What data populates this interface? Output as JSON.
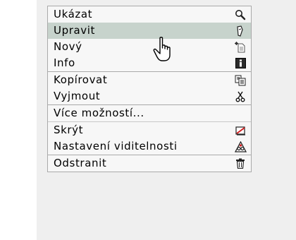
{
  "menu": {
    "items": [
      {
        "label": "Ukázat",
        "icon": "magnifier-icon"
      },
      {
        "label": "Upravit",
        "icon": "pencil-icon"
      },
      {
        "label": "Nový",
        "icon": "new-document-icon"
      },
      {
        "label": "Info",
        "icon": "info-icon"
      },
      {
        "label": "Kopírovat",
        "icon": "copy-icon"
      },
      {
        "label": "Vyjmout",
        "icon": "scissors-icon"
      },
      {
        "label": "Více možností...",
        "icon": ""
      },
      {
        "label": "Skrýt",
        "icon": "hide-icon"
      },
      {
        "label": "Nastavení viditelnosti",
        "icon": "visibility-settings-icon"
      },
      {
        "label": "Odstranit",
        "icon": "trash-icon"
      }
    ],
    "highlighted_index": 1
  },
  "colors": {
    "highlight": "#c7d3cc",
    "menu_bg": "#f7f7f7",
    "border": "#a9a9a9",
    "backdrop": "#efefef"
  }
}
